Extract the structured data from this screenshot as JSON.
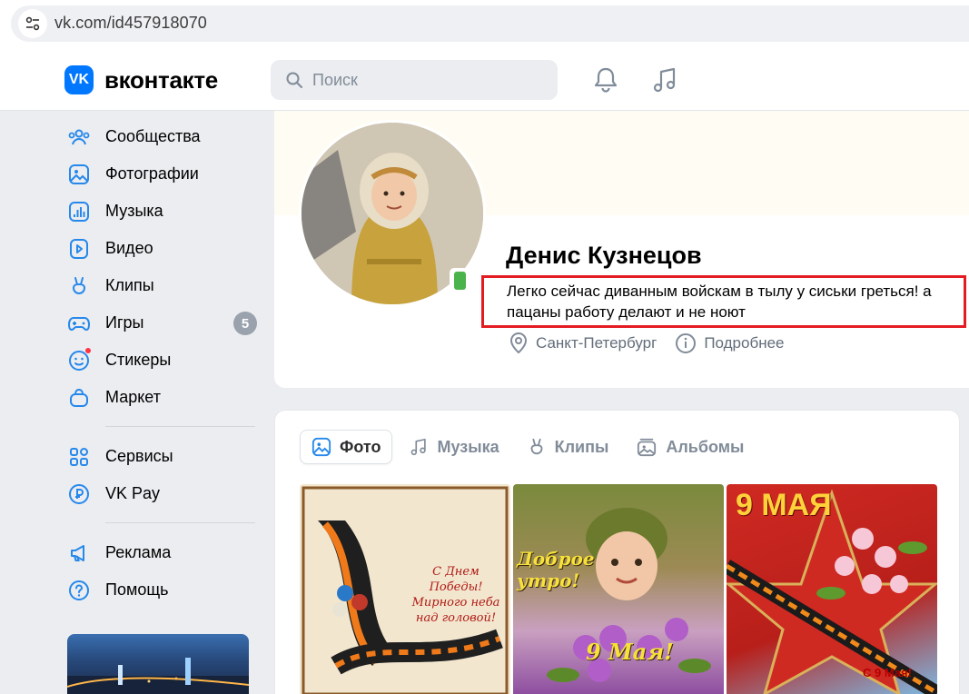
{
  "browser": {
    "url": "vk.com/id457918070"
  },
  "header": {
    "logo_text": "вконтакте",
    "search_placeholder": "Поиск"
  },
  "sidebar": {
    "items": [
      {
        "label": "Сообщества",
        "icon": "communities-icon"
      },
      {
        "label": "Фотографии",
        "icon": "photos-icon"
      },
      {
        "label": "Музыка",
        "icon": "music-icon"
      },
      {
        "label": "Видео",
        "icon": "video-icon"
      },
      {
        "label": "Клипы",
        "icon": "clips-icon"
      },
      {
        "label": "Игры",
        "icon": "games-icon",
        "badge": "5"
      },
      {
        "label": "Стикеры",
        "icon": "stickers-icon"
      },
      {
        "label": "Маркет",
        "icon": "market-icon"
      },
      {
        "label": "Сервисы",
        "icon": "services-icon"
      },
      {
        "label": "VK Pay",
        "icon": "vkpay-icon"
      },
      {
        "label": "Реклама",
        "icon": "ads-icon"
      },
      {
        "label": "Помощь",
        "icon": "help-icon"
      }
    ]
  },
  "profile": {
    "name": "Денис Кузнецов",
    "status": "Легко сейчас диванным войскам в тылу у сиськи греться! а пацаны работу делают и не ноют",
    "city": "Санкт-Петербург",
    "details_label": "Подробнее"
  },
  "photos_section": {
    "tabs": [
      {
        "label": "Фото",
        "active": true
      },
      {
        "label": "Музыка",
        "active": false
      },
      {
        "label": "Клипы",
        "active": false
      },
      {
        "label": "Альбомы",
        "active": false
      }
    ],
    "photo1_caption": "С Днем Победы! Мирного неба над головой!",
    "photo2_caption_top": "Доброе утро!",
    "photo2_caption_bottom": "9 Мая!",
    "photo3_caption_top": "9 МАЯ",
    "photo3_caption_bottom": "С 9 Мая!"
  },
  "colors": {
    "accent": "#0077ff",
    "highlight_box": "#e31b23",
    "online": "#4bb34b"
  }
}
